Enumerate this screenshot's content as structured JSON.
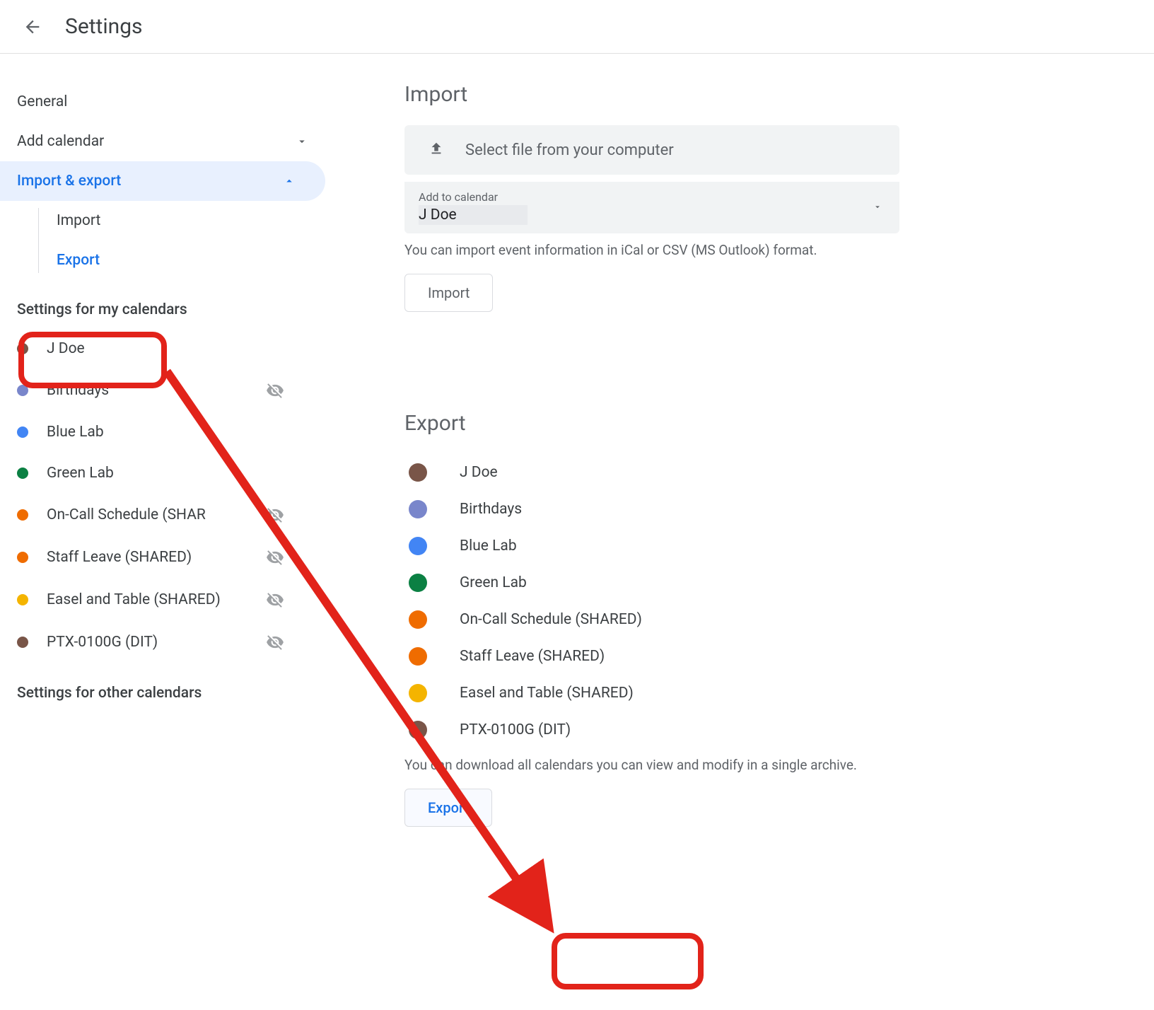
{
  "header": {
    "title": "Settings"
  },
  "sidebar": {
    "general": "General",
    "add_calendar": "Add calendar",
    "import_export": "Import & export",
    "sub": {
      "import": "Import",
      "export": "Export"
    },
    "my_calendars_title": "Settings for my calendars",
    "my_calendars": [
      {
        "label": "J Doe",
        "color": "#795548",
        "hidden": false
      },
      {
        "label": "Birthdays",
        "color": "#7986cb",
        "hidden": true
      },
      {
        "label": "Blue Lab",
        "color": "#4285f4",
        "hidden": false
      },
      {
        "label": "Green Lab",
        "color": "#0b8043",
        "hidden": false
      },
      {
        "label": "On-Call Schedule (SHAR",
        "color": "#ef6c00",
        "hidden": true
      },
      {
        "label": "Staff Leave (SHARED)",
        "color": "#ef6c00",
        "hidden": true
      },
      {
        "label": "Easel and Table (SHARED)",
        "color": "#f4b400",
        "hidden": true
      },
      {
        "label": "PTX-0100G (DIT)",
        "color": "#795548",
        "hidden": true
      }
    ],
    "other_calendars_title": "Settings for other calendars"
  },
  "import_section": {
    "title": "Import",
    "select_file": "Select file from your computer",
    "add_to_label": "Add to calendar",
    "add_to_value": "J Doe",
    "help": "You can import event information in iCal or CSV (MS Outlook) format.",
    "button": "Import"
  },
  "export_section": {
    "title": "Export",
    "calendars": [
      {
        "label": "J Doe",
        "color": "#795548"
      },
      {
        "label": "Birthdays",
        "color": "#7986cb"
      },
      {
        "label": "Blue Lab",
        "color": "#4285f4"
      },
      {
        "label": "Green Lab",
        "color": "#0b8043"
      },
      {
        "label": "On-Call Schedule (SHARED)",
        "color": "#ef6c00"
      },
      {
        "label": "Staff Leave (SHARED)",
        "color": "#ef6c00"
      },
      {
        "label": "Easel and Table (SHARED)",
        "color": "#f4b400"
      },
      {
        "label": "PTX-0100G (DIT)",
        "color": "#795548"
      }
    ],
    "help": "You can download all calendars you can view and modify in a single archive.",
    "button": "Export"
  }
}
